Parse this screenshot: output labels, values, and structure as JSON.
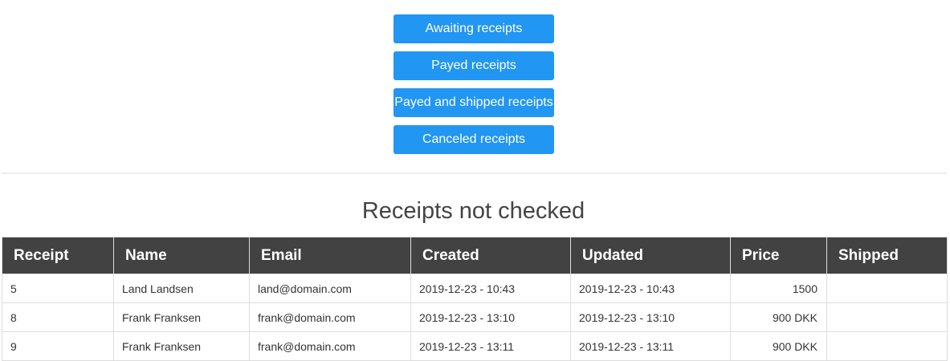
{
  "filters": {
    "buttons": [
      {
        "label": "Awaiting receipts"
      },
      {
        "label": "Payed receipts"
      },
      {
        "label": "Payed and shipped receipts"
      },
      {
        "label": "Canceled receipts"
      }
    ],
    "accent_color": "#2196f3"
  },
  "main": {
    "title": "Receipts not checked"
  },
  "table": {
    "header_color": "#424242",
    "columns": [
      "Receipt",
      "Name",
      "Email",
      "Created",
      "Updated",
      "Price",
      "Shipped"
    ],
    "rows": [
      {
        "receipt": "5",
        "name": "Land Landsen",
        "email": "land@domain.com",
        "created": "2019-12-23 - 10:43",
        "updated": "2019-12-23 - 10:43",
        "price": "1500",
        "shipped": ""
      },
      {
        "receipt": "8",
        "name": "Frank Franksen",
        "email": "frank@domain.com",
        "created": "2019-12-23 - 13:10",
        "updated": "2019-12-23 - 13:10",
        "price": "900 DKK",
        "shipped": ""
      },
      {
        "receipt": "9",
        "name": "Frank Franksen",
        "email": "frank@domain.com",
        "created": "2019-12-23 - 13:11",
        "updated": "2019-12-23 - 13:11",
        "price": "900 DKK",
        "shipped": ""
      }
    ]
  }
}
